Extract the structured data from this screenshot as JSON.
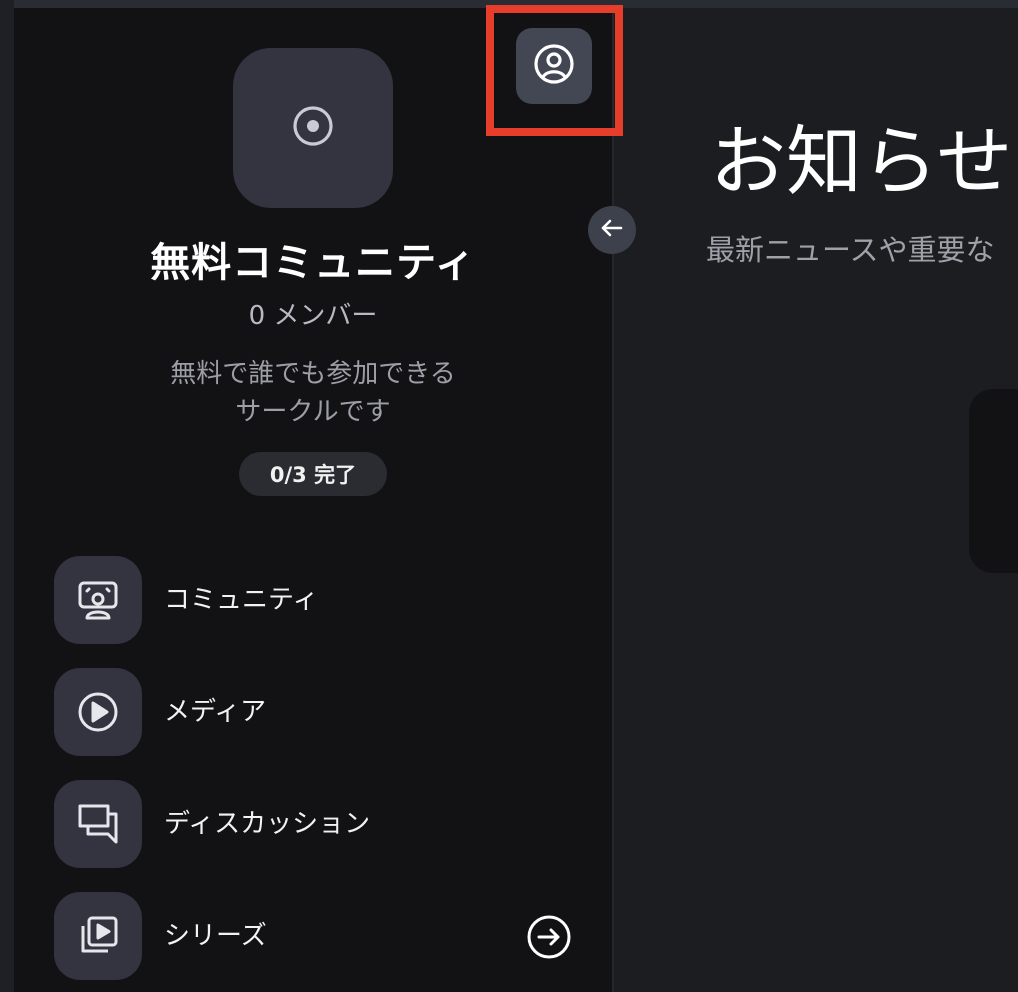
{
  "community": {
    "name": "無料コミュニティ",
    "member_count": "0 メンバー",
    "description_line1": "無料で誰でも参加できる",
    "description_line2": "サークルです",
    "progress": "0/3 完了",
    "logo_icon": "target-icon"
  },
  "nav": {
    "items": [
      {
        "label": "コミュニティ",
        "icon": "community-icon"
      },
      {
        "label": "メディア",
        "icon": "play-icon"
      },
      {
        "label": "ディスカッション",
        "icon": "chat-icon"
      },
      {
        "label": "シリーズ",
        "icon": "series-icon"
      }
    ]
  },
  "controls": {
    "profile_icon": "profile-icon",
    "collapse_icon": "arrow-left-icon",
    "next_icon": "arrow-right-circle-icon",
    "highlight_color": "#e63e2a"
  },
  "main": {
    "heading": "お知らせ",
    "subtitle": "最新ニュースや重要な"
  },
  "colors": {
    "sidebar_bg": "#121215",
    "main_bg": "#1c1d21",
    "icon_tile_bg": "#33343f"
  }
}
